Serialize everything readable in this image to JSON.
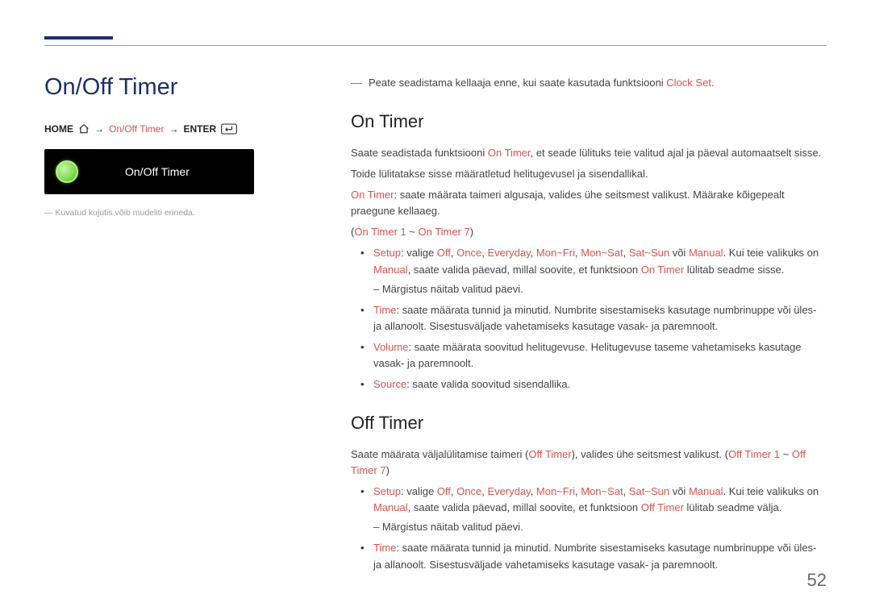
{
  "page": {
    "number": "52",
    "accent_color": "#1b2f6b",
    "highlight_color": "#d9534f"
  },
  "left": {
    "title": "On/Off Timer",
    "breadcrumb": {
      "home": "HOME",
      "arrow": "→",
      "item": "On/Off Timer",
      "enter": "ENTER"
    },
    "screenshot_label": "On/Off Timer",
    "note": "Kuvatud kujutis võib mudeliti erineda."
  },
  "right": {
    "pre_note": "Peate seadistama kellaaja enne, kui saate kasutada funktsiooni ",
    "pre_note_hl": "Clock Set",
    "pre_note_end": ".",
    "on": {
      "title": "On Timer",
      "p1a": "Saate seadistada funktsiooni ",
      "p1hl": "On Timer",
      "p1b": ", et seade lülituks teie valitud ajal ja päeval automaatselt sisse.",
      "p2": "Toide lülitatakse sisse määratletud helitugevusel ja sisendallikal.",
      "p3_hl": "On Timer",
      "p3": ": saate määrata taimeri algusaja, valides ühe seitsmest valikust. Määrake kõigepealt praegune kellaaeg.",
      "range_a": "On Timer 1",
      "range_sep": " ~ ",
      "range_b": "On Timer 7",
      "setup": {
        "label": "Setup",
        "a": ": valige ",
        "off": "Off",
        "c1": ", ",
        "once": "Once",
        "c2": ", ",
        "everyday": "Everyday",
        "c3": ", ",
        "monfri": "Mon~Fri",
        "c4": ", ",
        "monsat": "Mon~Sat",
        "c5": ", ",
        "satsun": "Sat~Sun",
        "mid": " või ",
        "manual": "Manual",
        "b": ". Kui teie valikuks on ",
        "manual2": "Manual",
        "c": ", saate valida päevad, millal soovite, et funktsioon ",
        "ontimer": "On Timer",
        "d": " lülitab seadme sisse.",
        "sub": "Märgistus näitab valitud päevi."
      },
      "time": {
        "label": "Time",
        "text": ": saate määrata tunnid ja minutid. Numbrite sisestamiseks kasutage numbrinuppe või üles- ja allanoolt. Sisestusväljade vahetamiseks kasutage vasak- ja paremnoolt."
      },
      "volume": {
        "label": "Volume",
        "text": ": saate määrata soovitud helitugevuse. Helitugevuse taseme vahetamiseks kasutage vasak- ja paremnoolt."
      },
      "source": {
        "label": "Source",
        "text": ": saate valida soovitud sisendallika."
      }
    },
    "off": {
      "title": "Off Timer",
      "p1a": "Saate määrata väljalülitamise taimeri (",
      "p1hl": "Off Timer",
      "p1b": "), valides ühe seitsmest valikust. (",
      "range_a": "Off Timer 1",
      "range_sep": " ~ ",
      "range_b": "Off Timer 7",
      "p1c": ")",
      "setup": {
        "label": "Setup",
        "a": ": valige ",
        "off": "Off",
        "c1": ", ",
        "once": "Once",
        "c2": ", ",
        "everyday": "Everyday",
        "c3": ", ",
        "monfri": "Mon~Fri",
        "c4": ", ",
        "monsat": "Mon~Sat",
        "c5": ", ",
        "satsun": "Sat~Sun",
        "mid": " või ",
        "manual": "Manual",
        "b": ". Kui teie valikuks on ",
        "manual2": "Manual",
        "c": ", saate valida päevad, millal soovite, et funktsioon ",
        "offtimer": "Off Timer",
        "d": " lülitab seadme välja.",
        "sub": "Märgistus näitab valitud päevi."
      },
      "time": {
        "label": "Time",
        "text": ": saate määrata tunnid ja minutid. Numbrite sisestamiseks kasutage numbrinuppe või üles- ja allanoolt. Sisestusväljade vahetamiseks kasutage vasak- ja paremnoolt."
      }
    }
  }
}
